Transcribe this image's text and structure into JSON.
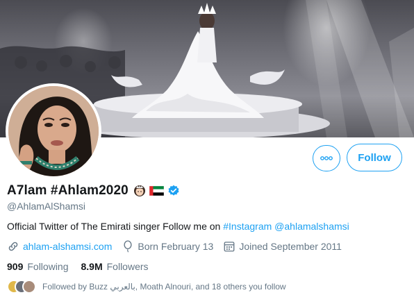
{
  "profile": {
    "name": "A7lam #Ahlam2020",
    "handle": "@AhlamAlShamsi",
    "verified": true,
    "bio_text": "Official Twitter of The Emirati singer Follow me on ",
    "bio_hashtag": "#Instagram",
    "bio_mention": "@ahlamalshamsi",
    "website": "ahlam-alshamsi.com",
    "born": "Born February 13",
    "joined": "Joined September 2011"
  },
  "stats": {
    "following_count": "909",
    "following_label": "Following",
    "followers_count": "8.9M",
    "followers_label": "Followers"
  },
  "followed_by": {
    "text": "Followed by Buzz بالعربي, Moath Alnouri, and 18 others you follow"
  },
  "actions": {
    "follow_label": "Follow"
  },
  "icons": {
    "more": "more-horizontal-icon",
    "link": "link-icon",
    "born": "balloon-icon",
    "joined": "calendar-icon",
    "verified": "verified-badge-icon"
  },
  "colors": {
    "accent": "#1da1f2",
    "secondary_text": "#657786",
    "primary_text": "#14171a"
  }
}
